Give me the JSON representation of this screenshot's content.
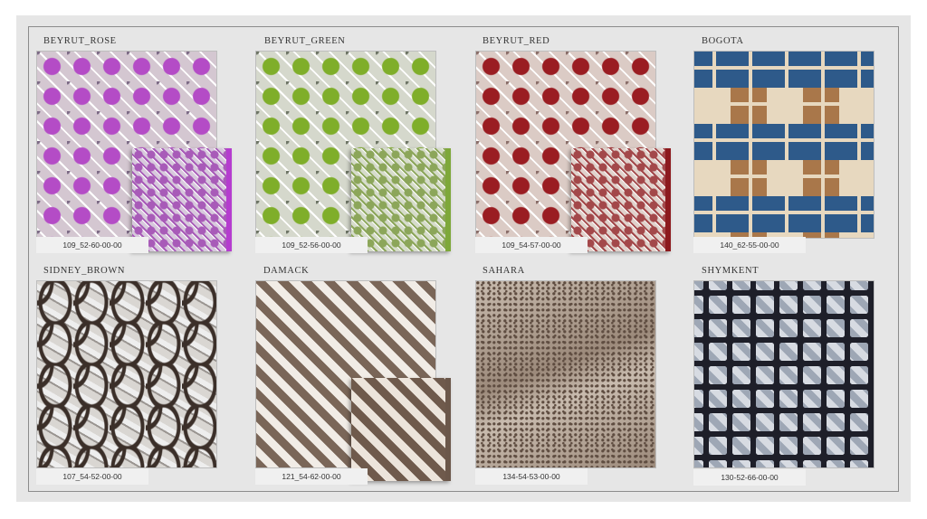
{
  "catalog": {
    "items": [
      {
        "title": "BEYRUT_ROSE",
        "code": "109_52-60-00-00",
        "pattern": "quatrefoil",
        "colors": [
          "#b44cc6",
          "#d4c7d1",
          "#7d6b86"
        ],
        "runner": {
          "pattern": "lattice",
          "colors": [
            "#a85bb8",
            "#d7c9dc"
          ],
          "edge": "#b53ccf"
        }
      },
      {
        "title": "BEYRUT_GREEN",
        "code": "109_52-56-00-00",
        "pattern": "quatrefoil",
        "colors": [
          "#7fae2a",
          "#d5d8cc",
          "#6e7566"
        ],
        "runner": {
          "pattern": "lattice",
          "colors": [
            "#8ca65a",
            "#d6dccb"
          ],
          "edge": "#7ea83a"
        }
      },
      {
        "title": "BEYRUT_RED",
        "code": "109_54-57-00-00",
        "pattern": "quatrefoil",
        "colors": [
          "#9a1d22",
          "#dbcbc5",
          "#8a6e69"
        ],
        "runner": {
          "pattern": "lattice",
          "colors": [
            "#a3484a",
            "#e0d2cc"
          ],
          "edge": "#8c1a1e"
        }
      },
      {
        "title": "BOGOTA",
        "code": "140_62-55-00-00",
        "pattern": "squares",
        "colors": [
          "#2e5a8a",
          "#a9774a",
          "#e7d8bf"
        ],
        "runner": null
      },
      {
        "title": "SIDNEY_BROWN",
        "code": "107_54-52-00-00",
        "pattern": "moroccan",
        "colors": [
          "#3b2f29",
          "#d9d6d2",
          "#9a9591"
        ],
        "runner": null
      },
      {
        "title": "DAMACK",
        "code": "121_54-62-00-00",
        "pattern": "diamonds",
        "colors": [
          "#7a6658",
          "#f1ece6",
          "#5e4a3c"
        ],
        "runner": {
          "pattern": "diamonds",
          "colors": [
            "#6f5a4c",
            "#ece4db"
          ],
          "edge": "#6b574a"
        }
      },
      {
        "title": "SAHARA",
        "code": "134-54-53-00-00",
        "pattern": "speckle",
        "colors": [
          "#9c8a7b",
          "#c8bbae",
          "#5f4d41"
        ],
        "runner": null
      },
      {
        "title": "SHYMKENT",
        "code": "130-52-66-00-00",
        "pattern": "crosses",
        "colors": [
          "#9ea7b5",
          "#d7dbe2",
          "#1e1f29"
        ],
        "runner": null
      }
    ]
  }
}
